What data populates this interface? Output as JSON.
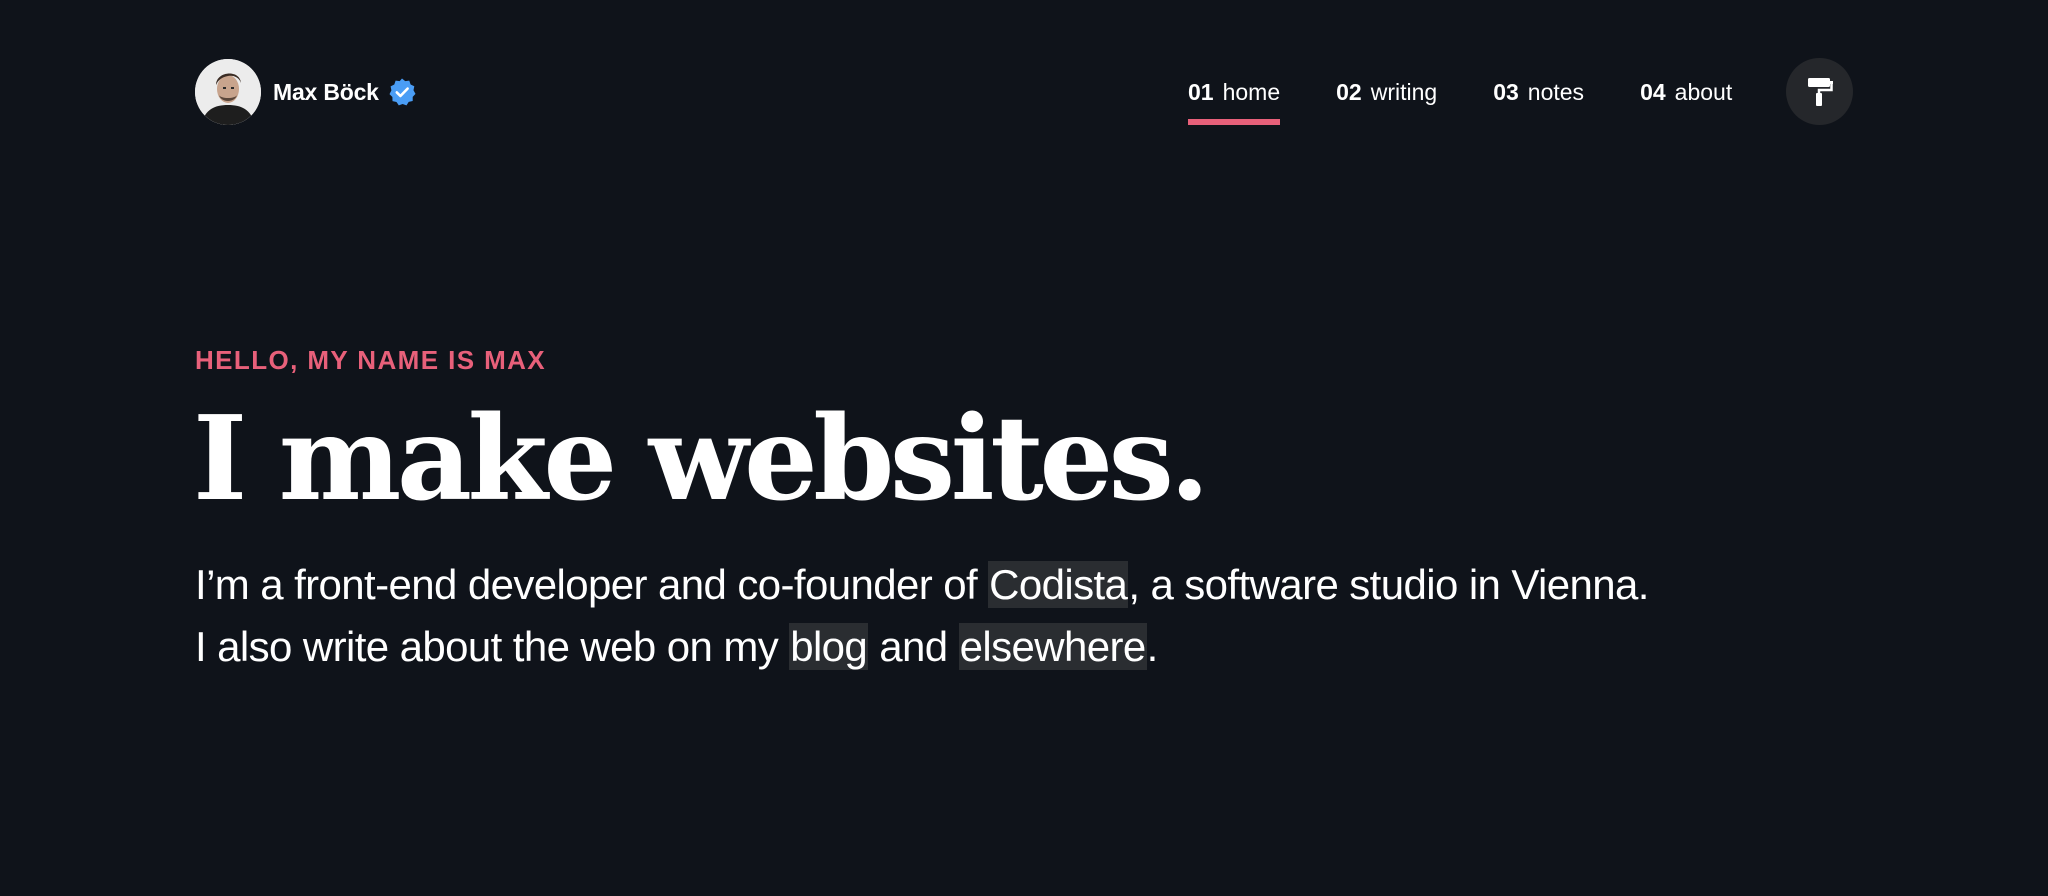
{
  "header": {
    "brand_name": "Max Böck",
    "avatar_icon": "person-portrait",
    "verified_icon": "verified-badge-icon",
    "verified_color": "#4a9df5",
    "nav": [
      {
        "num": "01",
        "label": "home",
        "active": true
      },
      {
        "num": "02",
        "label": "writing",
        "active": false
      },
      {
        "num": "03",
        "label": "notes",
        "active": false
      },
      {
        "num": "04",
        "label": "about",
        "active": false
      }
    ],
    "theme_button_icon": "paint-roller-icon"
  },
  "hero": {
    "eyebrow": "HELLO, MY NAME IS MAX",
    "headline": "I make websites.",
    "intro": {
      "line1_before": "I’m a front-end developer and co-founder of ",
      "line1_link": "Codista",
      "line1_after": ", a software studio in Vienna.",
      "line2_before": "I also write about the web on my ",
      "line2_link1": "blog",
      "line2_middle": " and ",
      "line2_link2": "elsewhere",
      "line2_after": "."
    }
  },
  "colors": {
    "background": "#0f131a",
    "accent": "#e8607a",
    "text": "#ffffff",
    "link_highlight": "#2a2d31"
  }
}
